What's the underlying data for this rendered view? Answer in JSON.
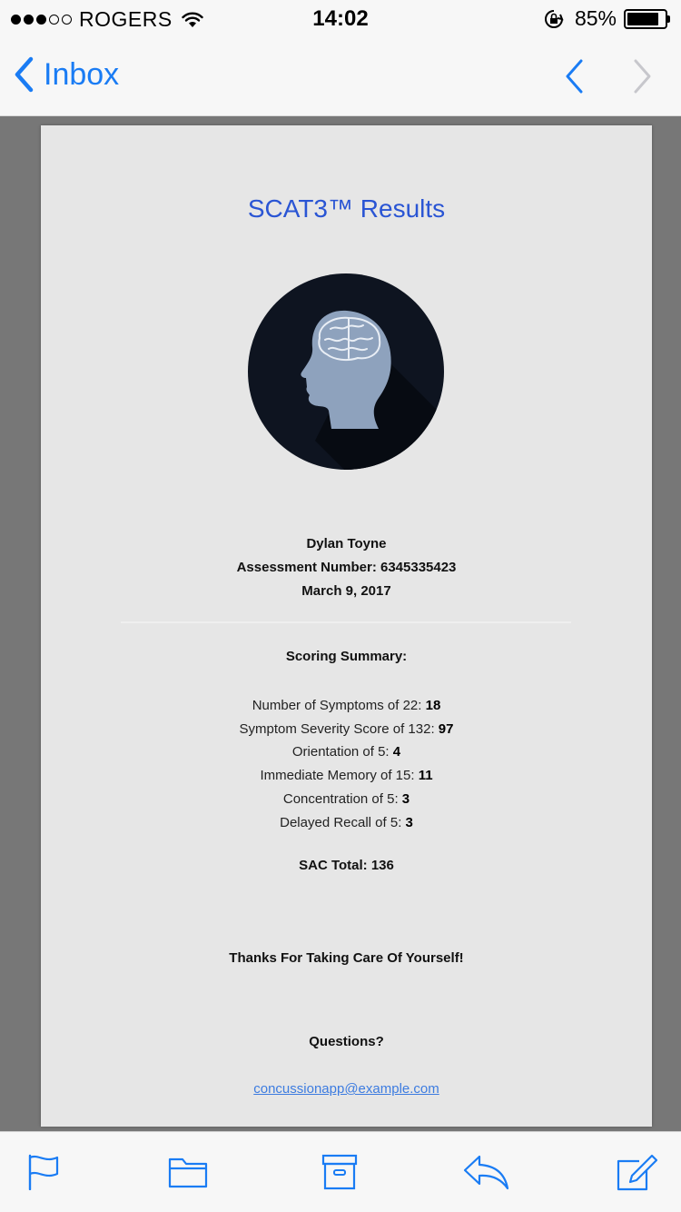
{
  "status_bar": {
    "carrier": "ROGERS",
    "time": "14:02",
    "battery": "85%",
    "battery_level": 0.85
  },
  "nav": {
    "back_label": "Inbox"
  },
  "email": {
    "title": "SCAT3™ Results",
    "patient_name": "Dylan Toyne",
    "assessment_number": "Assessment Number: 6345335423",
    "date": "March 9, 2017",
    "summary_heading": "Scoring Summary:",
    "scores": [
      {
        "label": "Number of Symptoms of 22: ",
        "value": "18"
      },
      {
        "label": "Symptom Severity Score of 132: ",
        "value": "97"
      },
      {
        "label": "Orientation of 5: ",
        "value": "4"
      },
      {
        "label": "Immediate Memory of 15: ",
        "value": "11"
      },
      {
        "label": "Concentration of 5: ",
        "value": "3"
      },
      {
        "label": "Delayed Recall of 5: ",
        "value": "3"
      }
    ],
    "sac_total": "SAC Total: 136",
    "thanks": "Thanks For Taking Care Of Yourself!",
    "questions": "Questions?",
    "contact_email": "concussionapp@example.com"
  },
  "toolbar": {
    "icons": [
      "flag-icon",
      "folder-icon",
      "archive-icon",
      "reply-icon",
      "compose-icon"
    ]
  },
  "colors": {
    "accent": "#1a7cf4",
    "title": "#2a55d4",
    "link": "#3d7ce0"
  }
}
